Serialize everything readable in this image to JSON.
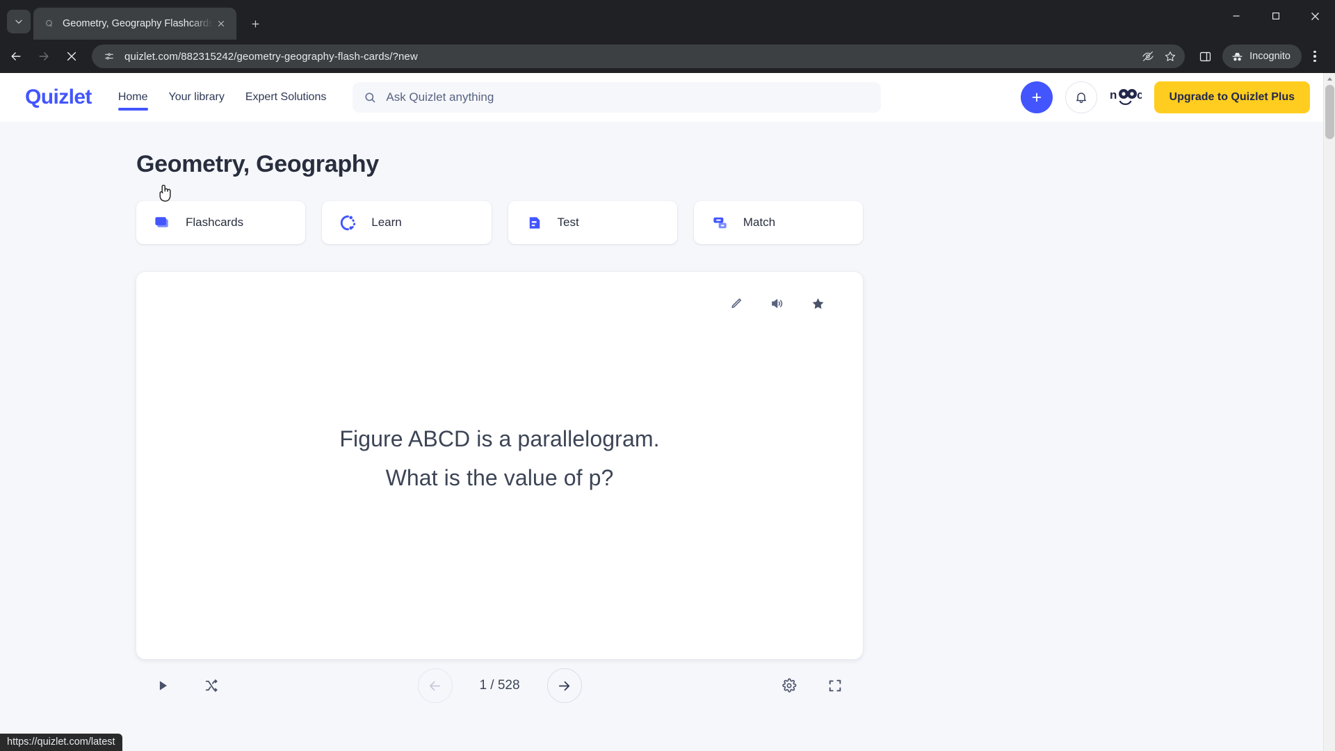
{
  "browser": {
    "tab": {
      "title": "Geometry, Geography Flashcards",
      "favicon_name": "quizlet-favicon",
      "close_label": "Close tab"
    },
    "new_tab_label": "New Tab",
    "tab_search_label": "Search tabs",
    "nav": {
      "back_label": "Back",
      "forward_label": "Forward",
      "stop_label": "Stop loading this page"
    },
    "omnibox": {
      "url": "quizlet.com/882315242/geometry-geography-flash-cards/?new",
      "site_info_label": "View site information",
      "tracking_label": "Tracking protection",
      "bookmark_label": "Bookmark this tab"
    },
    "side_panel_label": "Side panel",
    "profile": {
      "label": "Incognito"
    },
    "menu_label": "Customize and control Google Chrome",
    "window": {
      "minimize": "Minimize",
      "maximize": "Maximize",
      "close": "Close"
    },
    "status_bubble": "https://quizlet.com/latest"
  },
  "site": {
    "logo": "Quizlet",
    "nav": [
      {
        "label": "Home",
        "active": true
      },
      {
        "label": "Your library",
        "active": false
      },
      {
        "label": "Expert Solutions",
        "active": false
      }
    ],
    "search": {
      "placeholder": "Ask Quizlet anything",
      "value": ""
    },
    "create_label": "Create",
    "notifications_label": "Notifications",
    "avatar_label": "Account",
    "upgrade_label": "Upgrade to Quizlet Plus",
    "accent_color": "#4255ff",
    "upgrade_color": "#ffcd1f"
  },
  "study": {
    "set_title": "Geometry, Geography",
    "modes": [
      {
        "label": "Flashcards",
        "icon": "cards-icon"
      },
      {
        "label": "Learn",
        "icon": "learn-circle-icon"
      },
      {
        "label": "Test",
        "icon": "test-document-icon"
      },
      {
        "label": "Match",
        "icon": "match-blocks-icon"
      }
    ],
    "card": {
      "tools": [
        {
          "name": "edit-icon",
          "label": "Edit"
        },
        {
          "name": "audio-icon",
          "label": "Play audio"
        },
        {
          "name": "star-icon",
          "label": "Star this card"
        }
      ],
      "lines": [
        "Figure ABCD is a parallelogram.",
        "What is the value of p?"
      ]
    },
    "controls": {
      "play_label": "Play",
      "shuffle_label": "Shuffle",
      "prev_label": "Previous card",
      "next_label": "Next card",
      "counter": "1 / 528",
      "current_index": 1,
      "total": 528,
      "settings_label": "Options",
      "fullscreen_label": "Fullscreen"
    }
  }
}
